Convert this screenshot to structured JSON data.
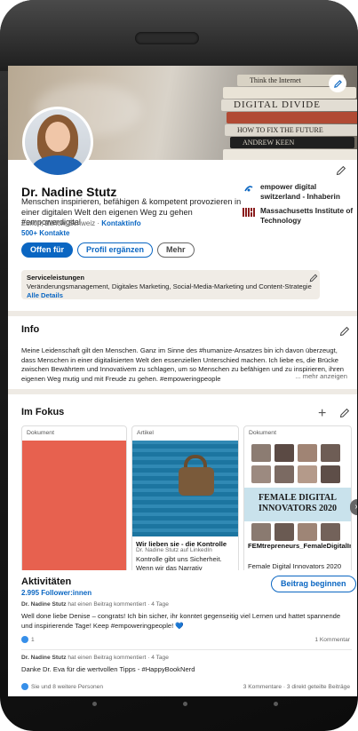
{
  "profile": {
    "name": "Dr. Nadine Stutz",
    "headline": "Menschen inspirieren, befähigen & kompetent provozieren in einer digitalen Welt den eigenen Weg zu gehen #empowerdigital",
    "location": "Zürich, Zürich, Schweiz · ",
    "contact_info": "Kontaktinfo",
    "contacts": "500+ Kontakte",
    "orgs": [
      {
        "name": "empower digital switzerland - Inhaberin",
        "logo": "empower-logo"
      },
      {
        "name": "Massachusetts Institute of Technology",
        "logo": "mit-logo"
      }
    ],
    "buttons": {
      "open_for": "Offen für",
      "complete_profile": "Profil ergänzen",
      "more": "Mehr"
    }
  },
  "banner": {
    "books": [
      "Think the Internet",
      "DIGITAL DIVIDE",
      "HOW TO FIX THE FUTURE",
      "ANDREW KEEN"
    ]
  },
  "services": {
    "title": "Serviceleistungen",
    "description": "Veränderungsmanagement, Digitales Marketing, Social-Media-Marketing und Content-Strategie",
    "link": "Alle Details"
  },
  "info": {
    "title": "Info",
    "text": "Meine Leidenschaft gilt den Menschen. Ganz im Sinne des #humanize-Ansatzes bin ich davon überzeugt, dass Menschen in einer digitalisierten Welt den essenziellen Unterschied machen. Ich liebe es, die Brücke zwischen Bewährtem und Innovativem zu schlagen, um so Menschen zu befähigen und zu inspirieren, ihren eigenen Weg mutig und mit Freude zu gehen. #empoweringpeople",
    "more": "... mehr anzeigen"
  },
  "focus": {
    "title": "Im Fokus",
    "cards": [
      {
        "tag": "Dokument"
      },
      {
        "tag": "Artikel",
        "title": "Wir lieben sie - die Kontrolle",
        "subtitle": "Dr. Nadine Stutz auf LinkedIn",
        "body": "Kontrolle gibt uns Sicherheit. Wenn wir das Narrativ bestimmen, kann uns nichts passieren. Wir entscheiden über unsere Botschaften,"
      },
      {
        "tag": "Dokument",
        "banner": "FEMALE DIGITAL INNOVATORS 2020",
        "title": "FEMtrepreneurs_FemaleDigitalInnovators2020.pdf",
        "subtitle": "Female Digital Innovators 2020"
      }
    ]
  },
  "activity": {
    "title": "Aktivitäten",
    "followers": "2.995 Follower:innen",
    "start_post": "Beitrag beginnen",
    "posts": [
      {
        "author": "Dr. Nadine Stutz",
        "meta": " hat einen Beitrag kommentiert · 4 Tage",
        "text": "Well done liebe Denise – congrats! Ich bin sicher, ihr konntet gegenseitig viel Lernen und hattet spannende und inspirierende Tage! Keep #empoweringpeople! 💙",
        "reactions": "1",
        "comments": "1 Kommentar"
      },
      {
        "author": "Dr. Nadine Stutz",
        "meta": " hat einen Beitrag kommentiert · 4 Tage",
        "text": "Danke Dr. Eva für die wertvollen Tipps - #HappyBookNerd",
        "reactions": "Sie und 8 weitere Personen",
        "comments": "3 Kommentare · 3 direkt geteilte Beiträge"
      }
    ]
  },
  "colors": {
    "accent": "#0a66c2",
    "services_bg": "#f0ece6",
    "doc_red": "#e7614f",
    "door_blue": "#1e7fae"
  }
}
